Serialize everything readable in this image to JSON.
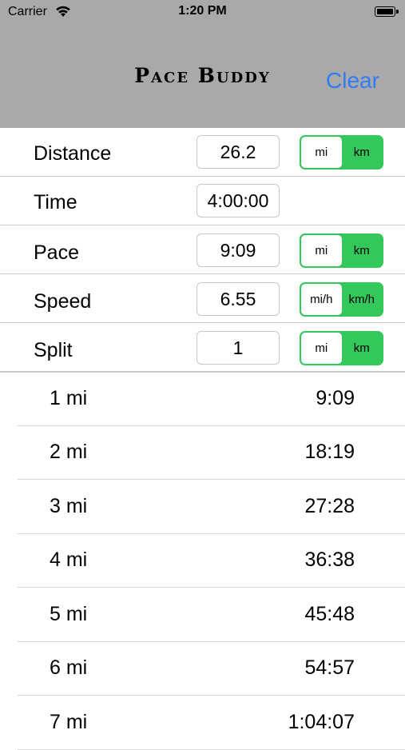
{
  "status": {
    "carrier": "Carrier",
    "time": "1:20 PM"
  },
  "header": {
    "title": "Pace Buddy",
    "clear_label": "Clear"
  },
  "form": {
    "rows": [
      {
        "label": "Distance",
        "value": "26.2",
        "units": [
          "mi",
          "km"
        ],
        "selected": 0
      },
      {
        "label": "Time",
        "value": "4:00:00"
      },
      {
        "label": "Pace",
        "value": "9:09",
        "units": [
          "mi",
          "km"
        ],
        "selected": 0
      },
      {
        "label": "Speed",
        "value": "6.55",
        "units": [
          "mi/h",
          "km/h"
        ],
        "selected": 0
      },
      {
        "label": "Split",
        "value": "1",
        "units": [
          "mi",
          "km"
        ],
        "selected": 0
      }
    ]
  },
  "splits": [
    {
      "label": "1 mi",
      "time": "9:09"
    },
    {
      "label": "2 mi",
      "time": "18:19"
    },
    {
      "label": "3 mi",
      "time": "27:28"
    },
    {
      "label": "4 mi",
      "time": "36:38"
    },
    {
      "label": "5 mi",
      "time": "45:48"
    },
    {
      "label": "6 mi",
      "time": "54:57"
    },
    {
      "label": "7 mi",
      "time": "1:04:07"
    }
  ],
  "colors": {
    "header_bg": "#a9a9a9",
    "accent_green": "#34c759",
    "link_blue": "#2f7cf6"
  }
}
